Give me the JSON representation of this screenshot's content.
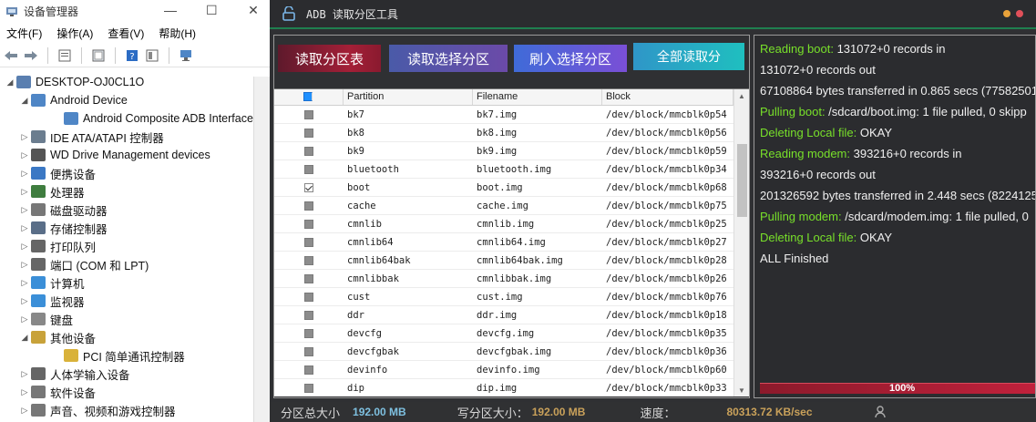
{
  "devmgr": {
    "title": "设备管理器",
    "menu": [
      "文件(F)",
      "操作(A)",
      "查看(V)",
      "帮助(H)"
    ],
    "tree": [
      {
        "level": 0,
        "expanded": true,
        "label": "DESKTOP-OJ0CL1O",
        "icon": "computer-icon",
        "color": "#5a7fb0"
      },
      {
        "level": 1,
        "expanded": true,
        "label": "Android Device",
        "icon": "android-device-icon",
        "color": "#4f86c6"
      },
      {
        "level": 2,
        "expanded": null,
        "label": "Android Composite ADB Interface",
        "icon": "adb-interface-icon",
        "color": "#4f86c6"
      },
      {
        "level": 1,
        "expanded": false,
        "label": "IDE ATA/ATAPI 控制器",
        "icon": "ide-controller-icon",
        "color": "#6b7d8f"
      },
      {
        "level": 1,
        "expanded": false,
        "label": "WD Drive Management devices",
        "icon": "wd-drive-icon",
        "color": "#555555"
      },
      {
        "level": 1,
        "expanded": false,
        "label": "便携设备",
        "icon": "portable-device-icon",
        "color": "#3b78c4"
      },
      {
        "level": 1,
        "expanded": false,
        "label": "处理器",
        "icon": "processor-icon",
        "color": "#3f7d3f"
      },
      {
        "level": 1,
        "expanded": false,
        "label": "磁盘驱动器",
        "icon": "disk-drive-icon",
        "color": "#777777"
      },
      {
        "level": 1,
        "expanded": false,
        "label": "存储控制器",
        "icon": "storage-controller-icon",
        "color": "#5a6e88"
      },
      {
        "level": 1,
        "expanded": false,
        "label": "打印队列",
        "icon": "printer-icon",
        "color": "#666666"
      },
      {
        "level": 1,
        "expanded": false,
        "label": "端口 (COM 和 LPT)",
        "icon": "port-icon",
        "color": "#666666"
      },
      {
        "level": 1,
        "expanded": false,
        "label": "计算机",
        "icon": "computer-icon",
        "color": "#3b8fd8"
      },
      {
        "level": 1,
        "expanded": false,
        "label": "监视器",
        "icon": "monitor-icon",
        "color": "#3b8fd8"
      },
      {
        "level": 1,
        "expanded": false,
        "label": "键盘",
        "icon": "keyboard-icon",
        "color": "#888888"
      },
      {
        "level": 1,
        "expanded": true,
        "label": "其他设备",
        "icon": "other-devices-icon",
        "color": "#c8a23a"
      },
      {
        "level": 2,
        "expanded": null,
        "label": "PCI 简单通讯控制器",
        "icon": "warning-device-icon",
        "color": "#d9b23a"
      },
      {
        "level": 1,
        "expanded": false,
        "label": "人体学输入设备",
        "icon": "hid-icon",
        "color": "#666666"
      },
      {
        "level": 1,
        "expanded": false,
        "label": "软件设备",
        "icon": "software-device-icon",
        "color": "#777777"
      },
      {
        "level": 1,
        "expanded": false,
        "label": "声音、视频和游戏控制器",
        "icon": "sound-icon",
        "color": "#777777"
      }
    ]
  },
  "adb": {
    "title": "ADB 读取分区工具",
    "buttons": {
      "read_table": "读取分区表",
      "read_selected": "读取选择分区",
      "flash_selected": "刷入选择分区",
      "read_all": "全部读取分"
    },
    "table": {
      "headers": [
        "Partition",
        "Filename",
        "Block"
      ],
      "rows": [
        {
          "checked": false,
          "partition": "bk7",
          "filename": "bk7.img",
          "block": "/dev/block/mmcblk0p54"
        },
        {
          "checked": false,
          "partition": "bk8",
          "filename": "bk8.img",
          "block": "/dev/block/mmcblk0p56"
        },
        {
          "checked": false,
          "partition": "bk9",
          "filename": "bk9.img",
          "block": "/dev/block/mmcblk0p59"
        },
        {
          "checked": false,
          "partition": "bluetooth",
          "filename": "bluetooth.img",
          "block": "/dev/block/mmcblk0p34"
        },
        {
          "checked": true,
          "partition": "boot",
          "filename": "boot.img",
          "block": "/dev/block/mmcblk0p68"
        },
        {
          "checked": false,
          "partition": "cache",
          "filename": "cache.img",
          "block": "/dev/block/mmcblk0p75"
        },
        {
          "checked": false,
          "partition": "cmnlib",
          "filename": "cmnlib.img",
          "block": "/dev/block/mmcblk0p25"
        },
        {
          "checked": false,
          "partition": "cmnlib64",
          "filename": "cmnlib64.img",
          "block": "/dev/block/mmcblk0p27"
        },
        {
          "checked": false,
          "partition": "cmnlib64bak",
          "filename": "cmnlib64bak.img",
          "block": "/dev/block/mmcblk0p28"
        },
        {
          "checked": false,
          "partition": "cmnlibbak",
          "filename": "cmnlibbak.img",
          "block": "/dev/block/mmcblk0p26"
        },
        {
          "checked": false,
          "partition": "cust",
          "filename": "cust.img",
          "block": "/dev/block/mmcblk0p76"
        },
        {
          "checked": false,
          "partition": "ddr",
          "filename": "ddr.img",
          "block": "/dev/block/mmcblk0p18"
        },
        {
          "checked": false,
          "partition": "devcfg",
          "filename": "devcfg.img",
          "block": "/dev/block/mmcblk0p35"
        },
        {
          "checked": false,
          "partition": "devcfgbak",
          "filename": "devcfgbak.img",
          "block": "/dev/block/mmcblk0p36"
        },
        {
          "checked": false,
          "partition": "devinfo",
          "filename": "devinfo.img",
          "block": "/dev/block/mmcblk0p60"
        },
        {
          "checked": false,
          "partition": "dip",
          "filename": "dip.img",
          "block": "/dev/block/mmcblk0p33"
        }
      ]
    },
    "log": [
      {
        "hl": "Reading boot:",
        "text": " 131072+0 records in"
      },
      {
        "hl": "",
        "text": "131072+0 records out"
      },
      {
        "hl": "",
        "text": "67108864 bytes transferred in 0.865 secs (77582501"
      },
      {
        "hl": "Pulling boot:",
        "text": " /sdcard/boot.img: 1 file pulled, 0 skipp"
      },
      {
        "hl": "Deleting Local file:",
        "text": " OKAY"
      },
      {
        "hl": "Reading modem:",
        "text": " 393216+0 records in"
      },
      {
        "hl": "",
        "text": "393216+0 records out"
      },
      {
        "hl": "",
        "text": "201326592 bytes transferred in 2.448 secs (82241254"
      },
      {
        "hl": "Pulling modem:",
        "text": " /sdcard/modem.img: 1 file pulled, 0"
      },
      {
        "hl": "Deleting Local file:",
        "text": " OKAY"
      },
      {
        "hl": "",
        "text": "ALL Finished"
      }
    ],
    "progress": {
      "value": 1.0,
      "label": "100%"
    },
    "status": {
      "total_label": "分区总大小",
      "total_value": "192.00 MB",
      "write_label": "写分区大小：",
      "write_value": "192.00 MB",
      "speed_label": "速度：",
      "speed_value": "80313.72 KB/sec"
    },
    "colors": {
      "accent_green": "#78e02a",
      "title_underline": "#1f7f4f",
      "dot_orange": "#e8a23a",
      "dot_red": "#e0505a"
    }
  }
}
